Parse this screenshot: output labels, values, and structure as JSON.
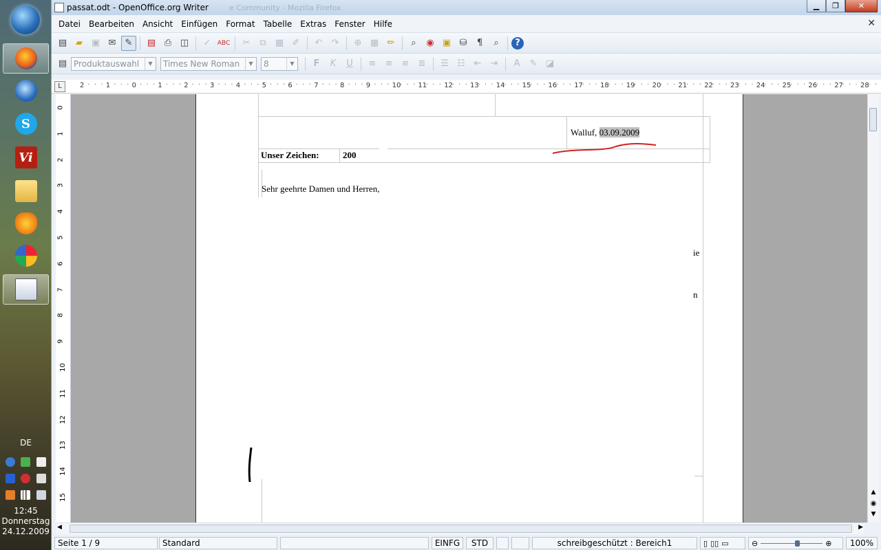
{
  "taskbar": {
    "language": "DE",
    "clock": {
      "time": "12:45",
      "day": "Donnerstag",
      "date": "24.12.2009"
    },
    "apps": [
      {
        "icon": "windows-orb-icon"
      },
      {
        "icon": "firefox-icon",
        "active": true
      },
      {
        "icon": "thunderbird-icon"
      },
      {
        "icon": "skype-icon",
        "letter": "S"
      },
      {
        "icon": "vi-icon",
        "letter": "Vi"
      },
      {
        "icon": "explorer-folder-icon"
      },
      {
        "icon": "lotus-icon"
      },
      {
        "icon": "picasa-icon"
      },
      {
        "icon": "openoffice-writer-icon",
        "active": true
      }
    ]
  },
  "window": {
    "title": "passat.odt - OpenOffice.org Writer",
    "ghost_title": "e Community - Mozilla Firefox",
    "minimize": "▁",
    "maximize": "❐",
    "close": "✕"
  },
  "menu": [
    "Datei",
    "Bearbeiten",
    "Ansicht",
    "Einfügen",
    "Format",
    "Tabelle",
    "Extras",
    "Fenster",
    "Hilfe"
  ],
  "formatting": {
    "style_placeholder": "Produktauswahl",
    "font": "Times New Roman",
    "size": "8"
  },
  "ruler": {
    "h_labels": [
      "2",
      "1",
      "0",
      "1",
      "2",
      "3",
      "4",
      "5",
      "6",
      "7",
      "8",
      "9",
      "10",
      "11",
      "12",
      "13",
      "14",
      "15",
      "16",
      "17",
      "18",
      "19",
      "20",
      "21",
      "22",
      "23",
      "24",
      "25",
      "26",
      "27",
      "28"
    ],
    "v_labels": [
      "0",
      "1",
      "2",
      "3",
      "4",
      "5",
      "6",
      "7",
      "8",
      "9",
      "10",
      "11",
      "12",
      "13",
      "14",
      "15"
    ]
  },
  "document": {
    "place": "Walluf, ",
    "date": "03.09.2009",
    "ref_label": "Unser Zeichen:",
    "ref_value": "200",
    "salutation": "Sehr geehrte Damen und Herren,",
    "fragment1": "ie",
    "fragment2": "n"
  },
  "status": {
    "page": "Seite 1 / 9",
    "style": "Standard",
    "insert_mode": "EINFG",
    "selection_mode": "STD",
    "section": "schreibgeschützt : Bereich1",
    "zoom": "100%"
  },
  "colors": {
    "annotation_red": "#d42020",
    "taskbar_top": "#4e6a76"
  }
}
